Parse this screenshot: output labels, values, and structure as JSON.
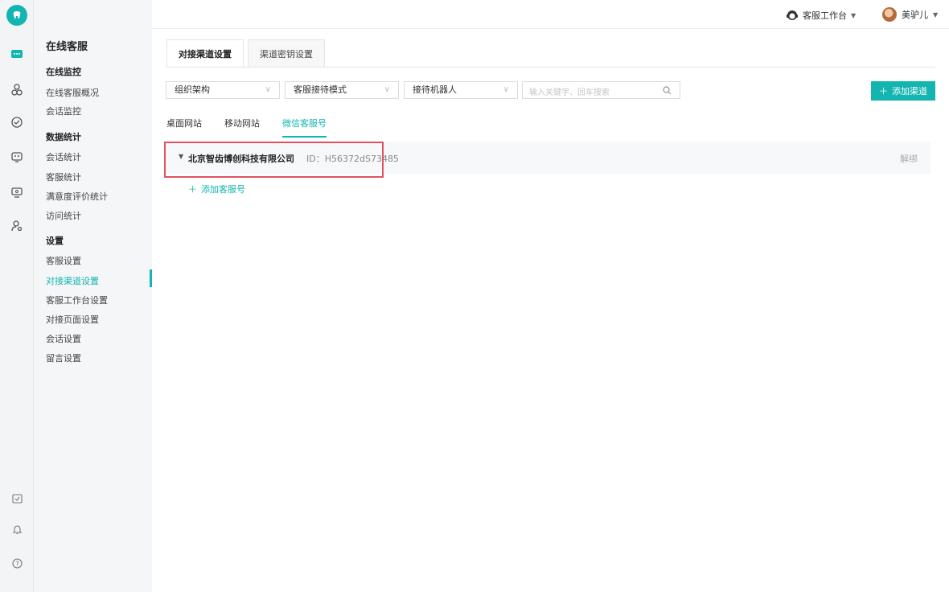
{
  "rail": {
    "icons": [
      "logo-icon",
      "chat-icon",
      "users-icon",
      "dashboard-icon",
      "robot-icon",
      "monitor-icon",
      "user-settings-icon",
      "calendar-check-icon",
      "bell-icon",
      "help-icon"
    ],
    "accent": "#13b5b1"
  },
  "subnav": {
    "title": "在线客服",
    "groups": [
      {
        "label": "在线监控",
        "items": [
          "在线客服概况",
          "会话监控"
        ]
      },
      {
        "label": "数据统计",
        "items": [
          "会话统计",
          "客服统计",
          "满意度评价统计",
          "访问统计"
        ]
      },
      {
        "label": "设置",
        "items": [
          "客服设置",
          "对接渠道设置",
          "客服工作台设置",
          "对接页面设置",
          "会话设置",
          "留言设置"
        ]
      }
    ],
    "active_item": "对接渠道设置"
  },
  "header": {
    "workbench": "客服工作台",
    "username": "美驴儿"
  },
  "main": {
    "tabs": [
      "对接渠道设置",
      "渠道密钥设置"
    ],
    "filters": {
      "org": "组织架构",
      "mode": "客服接待模式",
      "robot": "接待机器人",
      "search_placeholder": "输入关键字、回车搜索"
    },
    "add_channel": "添加渠道",
    "subtabs": [
      "桌面网站",
      "移动网站",
      "微信客服号"
    ],
    "row": {
      "company": "北京智齿博创科技有限公司",
      "id": "ID：H56372dS73485",
      "unbind": "解绑"
    },
    "add_account": "添加客服号"
  }
}
